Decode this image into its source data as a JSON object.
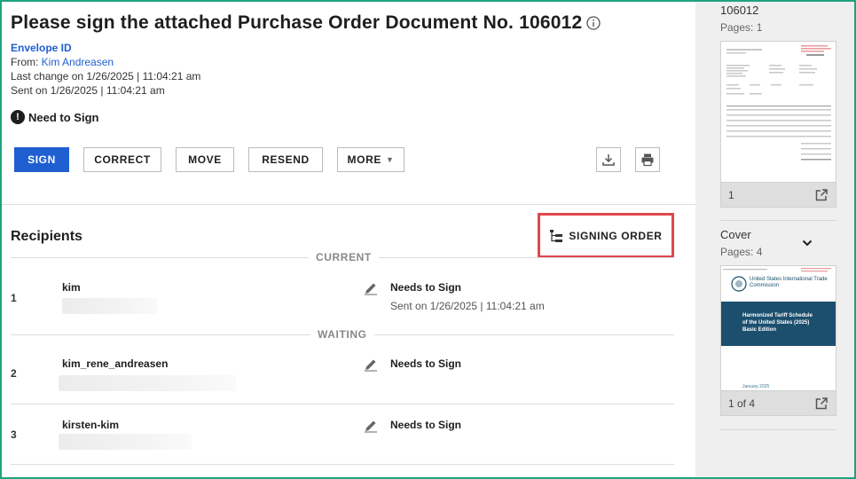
{
  "header": {
    "title": "Please sign the attached Purchase Order Document No. 106012",
    "envelope_id_label": "Envelope ID",
    "from_label": "From: ",
    "from_name": "Kim Andreasen",
    "last_change": "Last change on 1/26/2025 | 11:04:21 am",
    "sent_on": "Sent on 1/26/2025 | 11:04:21 am",
    "status": "Need to Sign"
  },
  "toolbar": {
    "sign": "SIGN",
    "correct": "CORRECT",
    "move": "MOVE",
    "resend": "RESEND",
    "more": "MORE"
  },
  "recipients": {
    "title": "Recipients",
    "signing_order": "SIGNING ORDER",
    "current_label": "CURRENT",
    "waiting_label": "WAITING",
    "rows": [
      {
        "num": "1",
        "name": "kim",
        "status": "Needs to Sign",
        "sub": "Sent on 1/26/2025 | 11:04:21 am"
      },
      {
        "num": "2",
        "name": "kim_rene_andreasen",
        "status": "Needs to Sign"
      },
      {
        "num": "3",
        "name": "kirsten-kim",
        "status": "Needs to Sign"
      }
    ]
  },
  "sidebar": {
    "doc1": {
      "title": "106012",
      "pages": "Pages: 1",
      "page_label": "1"
    },
    "doc2": {
      "title": "Cover",
      "pages": "Pages: 4",
      "page_label": "1 of 4",
      "thumb_org": "United States International Trade Commission",
      "thumb_heading": "Harmonized Tariff Schedule of the United States (2025) Basic Edition",
      "thumb_date": "January 2025"
    }
  },
  "colors": {
    "frame": "#1fa37f",
    "primary": "#1f5fd1",
    "highlight": "#e0484b",
    "thumb_band": "#1c4f6e"
  }
}
